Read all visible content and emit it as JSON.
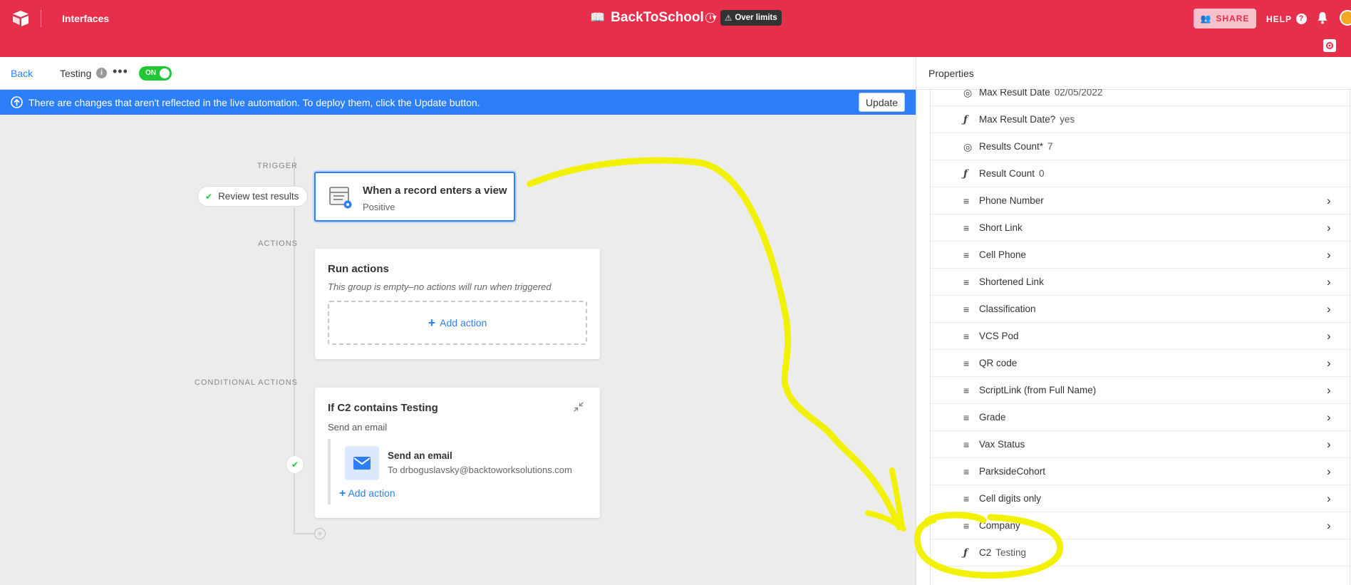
{
  "topbar": {
    "section": "Interfaces",
    "base_name": "BackToSchool",
    "limits_badge": "Over limits",
    "share_label": "SHARE",
    "help_label": "HELP"
  },
  "subheader": {
    "back_label": "Back",
    "automation_name": "Testing",
    "toggle_label": "ON"
  },
  "banner": {
    "message": "There are changes that aren't reflected in the live automation. To deploy them, click the Update button.",
    "update_label": "Update"
  },
  "canvas": {
    "trigger_label": "TRIGGER",
    "actions_label": "ACTIONS",
    "conditional_label": "CONDITIONAL ACTIONS",
    "test_pill": "Review test results",
    "trigger": {
      "title": "When a record enters a view",
      "subtitle": "Positive"
    },
    "run_actions": {
      "title": "Run actions",
      "empty_text": "This group is empty–no actions will run when triggered",
      "add_label": "Add action"
    },
    "conditional": {
      "title": "If C2 contains Testing",
      "summary": "Send an email",
      "action_title": "Send an email",
      "action_to": "To drboguslavsky@backtoworksolutions.com",
      "add_label": "Add action"
    }
  },
  "panel": {
    "title": "Properties",
    "fields": [
      {
        "name": "Max Result Date",
        "value": "02/05/2022",
        "icon": "rollup-icon",
        "chevron": false
      },
      {
        "name": "Max Result Date?",
        "value": "yes",
        "icon": "formula-icon",
        "chevron": false
      },
      {
        "name": "Results Count*",
        "value": "7",
        "icon": "rollup-icon",
        "chevron": false
      },
      {
        "name": "Result Count",
        "value": "0",
        "icon": "formula-icon",
        "chevron": false
      },
      {
        "name": "Phone Number",
        "value": "",
        "icon": "lookup-icon",
        "chevron": true
      },
      {
        "name": "Short Link",
        "value": "",
        "icon": "lookup-icon",
        "chevron": true
      },
      {
        "name": "Cell Phone",
        "value": "",
        "icon": "lookup-icon",
        "chevron": true
      },
      {
        "name": "Shortened Link",
        "value": "",
        "icon": "lookup-icon",
        "chevron": true
      },
      {
        "name": "Classification",
        "value": "",
        "icon": "lookup-icon",
        "chevron": true
      },
      {
        "name": "VCS Pod",
        "value": "",
        "icon": "lookup-icon",
        "chevron": true
      },
      {
        "name": "QR code",
        "value": "",
        "icon": "lookup-icon",
        "chevron": true
      },
      {
        "name": "ScriptLink (from Full Name)",
        "value": "",
        "icon": "lookup-icon",
        "chevron": true
      },
      {
        "name": "Grade",
        "value": "",
        "icon": "lookup-icon",
        "chevron": true
      },
      {
        "name": "Vax Status",
        "value": "",
        "icon": "lookup-icon",
        "chevron": true
      },
      {
        "name": "ParksideCohort",
        "value": "",
        "icon": "lookup-icon",
        "chevron": true
      },
      {
        "name": "Cell digits only",
        "value": "",
        "icon": "lookup-icon",
        "chevron": true
      },
      {
        "name": "Company",
        "value": "",
        "icon": "lookup-icon",
        "chevron": true
      },
      {
        "name": "C2",
        "value": "Testing",
        "icon": "formula-icon",
        "chevron": false
      }
    ]
  },
  "colors": {
    "brand_red": "#e6304b",
    "accent_blue": "#2d7ff9",
    "success_green": "#20c933",
    "annotation_yellow": "#f2f200"
  }
}
